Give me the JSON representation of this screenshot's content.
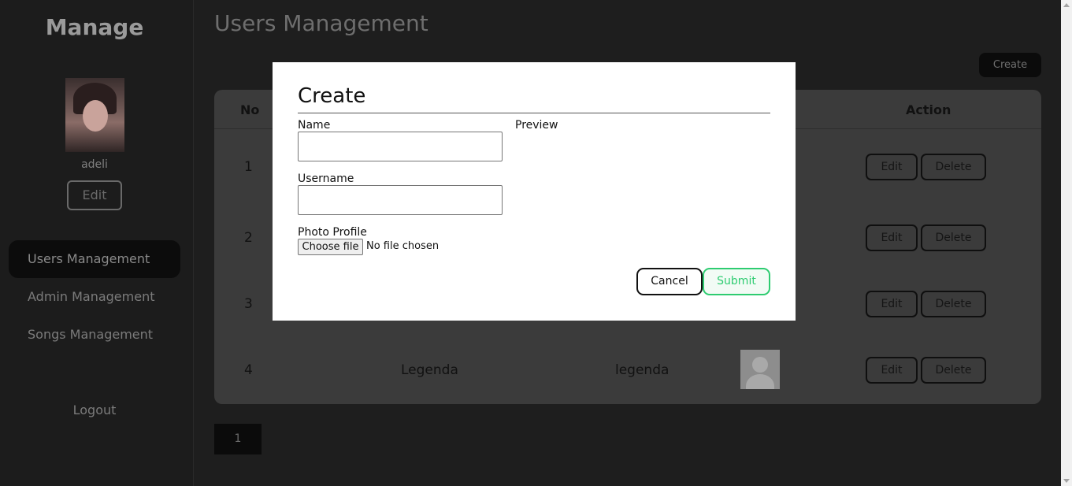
{
  "sidebar": {
    "brand": "Manage",
    "username": "adeli",
    "edit_label": "Edit",
    "items": [
      {
        "label": "Users Management"
      },
      {
        "label": "Admin Management"
      },
      {
        "label": "Songs Management"
      }
    ],
    "logout_label": "Logout"
  },
  "main": {
    "title": "Users Management",
    "create_label": "Create",
    "table": {
      "columns": [
        "No",
        "Action"
      ],
      "rows": [
        {
          "no": "1",
          "name": "",
          "username": ""
        },
        {
          "no": "2",
          "name": "",
          "username": ""
        },
        {
          "no": "3",
          "name": "",
          "username": ""
        },
        {
          "no": "4",
          "name": "Legenda",
          "username": "legenda"
        }
      ],
      "edit_label": "Edit",
      "delete_label": "Delete"
    },
    "pagination": {
      "current": "1"
    }
  },
  "modal": {
    "title": "Create",
    "name_label": "Name",
    "name_value": "",
    "username_label": "Username",
    "username_value": "",
    "preview_label": "Preview",
    "photo_label": "Photo Profile",
    "file_button_label": "Choose file",
    "file_status": "No file chosen",
    "cancel_label": "Cancel",
    "submit_label": "Submit"
  },
  "colors": {
    "submit_accent": "#2ecc71",
    "active_nav_bg": "#0c0c0c"
  }
}
